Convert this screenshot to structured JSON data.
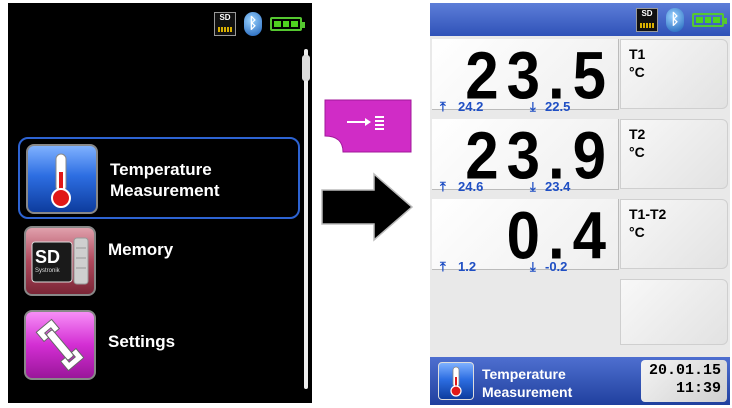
{
  "left_screen": {
    "status": {
      "sd_label": "SD",
      "bluetooth_icon": "bluetooth-icon",
      "battery_icon": "battery-icon"
    },
    "menu": [
      {
        "line1": "Temperature",
        "line2": "Measurement",
        "icon": "thermometer-icon",
        "selected": true
      },
      {
        "line1": "Memory",
        "line2": "",
        "icon": "sd-card-icon",
        "icon_text": "SD",
        "icon_subtext": "Systronik",
        "selected": false
      },
      {
        "line1": "Settings",
        "line2": "",
        "icon": "wrench-icon",
        "selected": false
      }
    ]
  },
  "key_button": {
    "icon": "arrow-to-list-icon",
    "color": "#d02cc6"
  },
  "transition_arrow": {
    "icon": "right-arrow-icon"
  },
  "right_screen": {
    "status": {
      "sd_label": "SD",
      "bluetooth_icon": "bluetooth-icon",
      "battery_icon": "battery-icon"
    },
    "readings": [
      {
        "value": "23.5",
        "channel": "T1",
        "unit": "°C",
        "max": "24.2",
        "min": "22.5"
      },
      {
        "value": "23.9",
        "channel": "T2",
        "unit": "°C",
        "max": "24.6",
        "min": "23.4"
      },
      {
        "value": "0.4",
        "channel": "T1-T2",
        "unit": "°C",
        "max": "1.2",
        "min": "-0.2"
      }
    ],
    "bottom": {
      "title_line1": "Temperature",
      "title_line2": "Measurement",
      "date": "20.01.15",
      "time": "11:39"
    }
  },
  "colors": {
    "accent_blue": "#2d63d2",
    "minmax_blue": "#1f4fc4",
    "battery_green": "#4fd21f",
    "key_magenta": "#d02cc6"
  }
}
